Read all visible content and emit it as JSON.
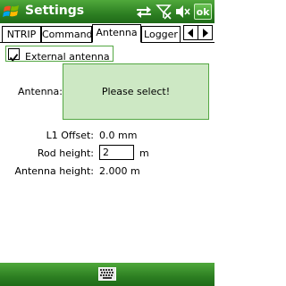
{
  "titlebar": {
    "title": "Settings",
    "ok_label": "ok",
    "icons": [
      "windows-start-icon",
      "connectivity-icon",
      "signal-off-icon",
      "volume-off-icon"
    ]
  },
  "tabs": [
    {
      "label": "NTRIP",
      "active": false
    },
    {
      "label": "Command",
      "active": false
    },
    {
      "label": "Antenna",
      "active": true
    },
    {
      "label": "Logger",
      "active": false
    }
  ],
  "external_antenna": {
    "label": "External antenna",
    "checked": true
  },
  "antenna": {
    "label": "Antenna:",
    "value": "Please select!"
  },
  "l1_offset": {
    "label": "L1 Offset:",
    "value": "0.0 mm"
  },
  "rod_height": {
    "label": "Rod height:",
    "value": "2",
    "unit": "m"
  },
  "antenna_height": {
    "label": "Antenna height:",
    "value": "2.000 m"
  },
  "colors": {
    "bar_green": "#2d7f22",
    "select_fill": "#cde8c4",
    "select_border": "#54a743"
  },
  "bottombar": {
    "icons": [
      "keyboard-icon"
    ]
  }
}
